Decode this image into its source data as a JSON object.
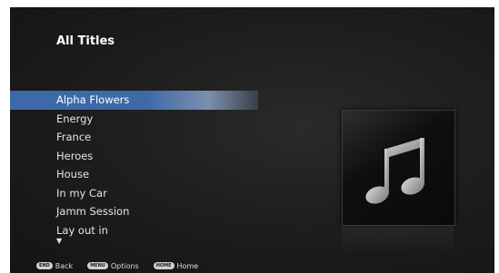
{
  "header": {
    "title": "All Titles"
  },
  "list": {
    "items": [
      {
        "label": "Alpha Flowers",
        "selected": true
      },
      {
        "label": "Energy"
      },
      {
        "label": "France"
      },
      {
        "label": "Heroes"
      },
      {
        "label": "House"
      },
      {
        "label": "In my Car"
      },
      {
        "label": "Jamm Session"
      },
      {
        "label": "Lay out in"
      }
    ],
    "more_indicator": "▼"
  },
  "artwork": {
    "icon": "music-note-icon"
  },
  "footer": {
    "back_key": "END",
    "back_label": "Back",
    "options_key": "MENU",
    "options_label": "Options",
    "home_key": "HOME",
    "home_label": "Home"
  },
  "colors": {
    "selection": "#3d69a8",
    "background": "#1c1c1c"
  }
}
